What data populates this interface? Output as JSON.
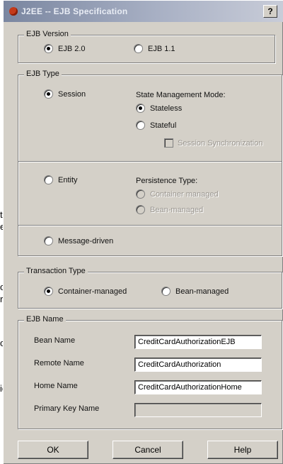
{
  "background_fragments": [
    "ti",
    "e",
    "o",
    "r",
    "or",
    "id"
  ],
  "dialog": {
    "title": "J2EE -- EJB Specification",
    "help_glyph": "?"
  },
  "ejb_version": {
    "legend": "EJB Version",
    "options": [
      {
        "label": "EJB 2.0",
        "selected": true
      },
      {
        "label": "EJB 1.1",
        "selected": false
      }
    ]
  },
  "ejb_type": {
    "legend": "EJB Type",
    "session": {
      "label": "Session",
      "selected": true
    },
    "state_mode": {
      "label": "State Management Mode:",
      "options": [
        {
          "label": "Stateless",
          "selected": true
        },
        {
          "label": "Stateful",
          "selected": false
        }
      ],
      "sync_checkbox": {
        "label": "Session Synchronization",
        "checked": false,
        "enabled": false
      }
    },
    "entity": {
      "label": "Entity",
      "selected": false
    },
    "persistence": {
      "label": "Persistence Type:",
      "options": [
        {
          "label": "Container managed",
          "enabled": false
        },
        {
          "label": "Bean-managed",
          "enabled": false
        }
      ]
    },
    "message_driven": {
      "label": "Message-driven",
      "selected": false
    }
  },
  "transaction": {
    "legend": "Transaction Type",
    "options": [
      {
        "label": "Container-managed",
        "selected": true
      },
      {
        "label": "Bean-managed",
        "selected": false
      }
    ]
  },
  "ejb_name": {
    "legend": "EJB Name",
    "fields": [
      {
        "label": "Bean Name",
        "value": "CreditCardAuthorizationEJB"
      },
      {
        "label": "Remote Name",
        "value": "CreditCardAuthorization"
      },
      {
        "label": "Home Name",
        "value": "CreditCardAuthorizationHome"
      },
      {
        "label": "Primary Key Name",
        "value": ""
      }
    ]
  },
  "buttons": {
    "ok": "OK",
    "cancel": "Cancel",
    "help": "Help"
  }
}
